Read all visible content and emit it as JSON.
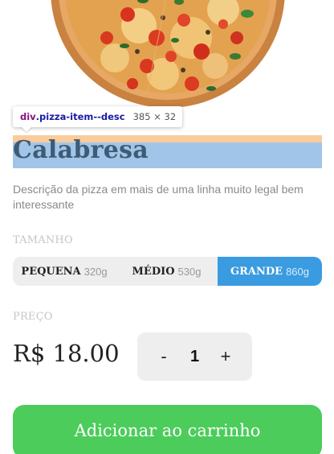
{
  "pizza": {
    "name": "Calabresa",
    "description": "Descrição da pizza em mais de uma linha muito legal bem interessante"
  },
  "inspector": {
    "tag": "div",
    "class_name": ".pizza-item--desc",
    "dimensions": "385 × 32"
  },
  "size_section": {
    "label": "TAMANHO",
    "options": [
      {
        "name": "PEQUENA",
        "weight": "320g",
        "selected": false
      },
      {
        "name": "MÉDIO",
        "weight": "530g",
        "selected": false
      },
      {
        "name": "GRANDE",
        "weight": "860g",
        "selected": true
      }
    ]
  },
  "price_section": {
    "label": "PREÇO",
    "value": "R$ 18.00"
  },
  "quantity": {
    "minus": "-",
    "value": "1",
    "plus": "+"
  },
  "add_to_cart": {
    "label": "Adicionar ao carrinho"
  },
  "colors": {
    "accent_blue": "#3a9be1",
    "add_green": "#4ccc5b",
    "highlight_content": "#a0c5e8",
    "highlight_margin": "#f9cc9d"
  }
}
